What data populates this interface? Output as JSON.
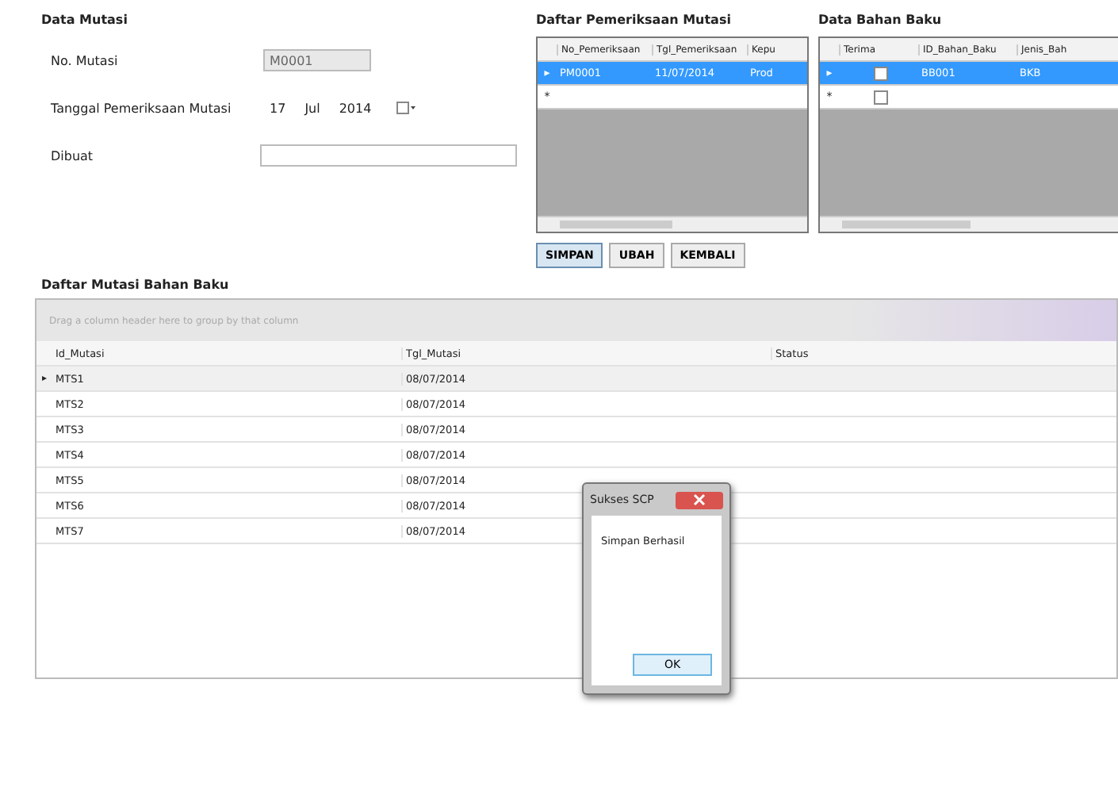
{
  "mutasi_form": {
    "title": "Data Mutasi",
    "fields": [
      {
        "kind": "text",
        "label": "No. Mutasi",
        "value": "M0001",
        "disabled": true
      },
      {
        "kind": "date",
        "label": "Tanggal Pemeriksaan Mutasi",
        "day": "17",
        "month": "Jul",
        "year": "2014"
      },
      {
        "kind": "text",
        "label": "Dibuat",
        "disabled": false
      }
    ]
  },
  "pemeriksaan_grid": {
    "title": "Daftar Pemeriksaan Mutasi",
    "columns": [
      "No_Pemeriksaan",
      "Tgl_Pemeriksaan",
      "Kepu"
    ],
    "rows": [
      {
        "marker": "▸",
        "selected": true,
        "cells": [
          "PM0001",
          "11/07/2014",
          "Prod"
        ]
      },
      {
        "marker": "*",
        "selected": false,
        "cells": [
          "",
          "",
          ""
        ]
      }
    ]
  },
  "bahan_grid": {
    "title": "Data Bahan Baku",
    "columns": [
      "Terima",
      "ID_Bahan_Baku",
      "Jenis_Bah"
    ],
    "rows": [
      {
        "marker": "▸",
        "selected": true,
        "checked": false,
        "cells": [
          "",
          "BB001",
          "BKB"
        ]
      },
      {
        "marker": "*",
        "selected": false,
        "checked": false,
        "cells": [
          "",
          "",
          ""
        ]
      }
    ]
  },
  "buttons": [
    {
      "label": "SIMPAN",
      "selected": true
    },
    {
      "label": "UBAH",
      "selected": false
    },
    {
      "label": "KEMBALI",
      "selected": false
    }
  ],
  "mutasi_list": {
    "title": "Daftar Mutasi Bahan Baku",
    "group_hint": "Drag a column header here to group by that column",
    "columns": [
      "Id_Mutasi",
      "Tgl_Mutasi",
      "Status"
    ],
    "rows": [
      {
        "marker": "▸",
        "cells": [
          "MTS1",
          "08/07/2014",
          ""
        ]
      },
      {
        "marker": "",
        "cells": [
          "MTS2",
          "08/07/2014",
          ""
        ]
      },
      {
        "marker": "",
        "cells": [
          "MTS3",
          "08/07/2014",
          ""
        ]
      },
      {
        "marker": "",
        "cells": [
          "MTS4",
          "08/07/2014",
          ""
        ]
      },
      {
        "marker": "",
        "cells": [
          "MTS5",
          "08/07/2014",
          ""
        ]
      },
      {
        "marker": "",
        "cells": [
          "MTS6",
          "08/07/2014",
          ""
        ]
      },
      {
        "marker": "",
        "cells": [
          "MTS7",
          "08/07/2014",
          ""
        ]
      }
    ]
  },
  "dialog": {
    "title": "Sukses SCP",
    "message": "Simpan Berhasil",
    "button": "OK"
  }
}
